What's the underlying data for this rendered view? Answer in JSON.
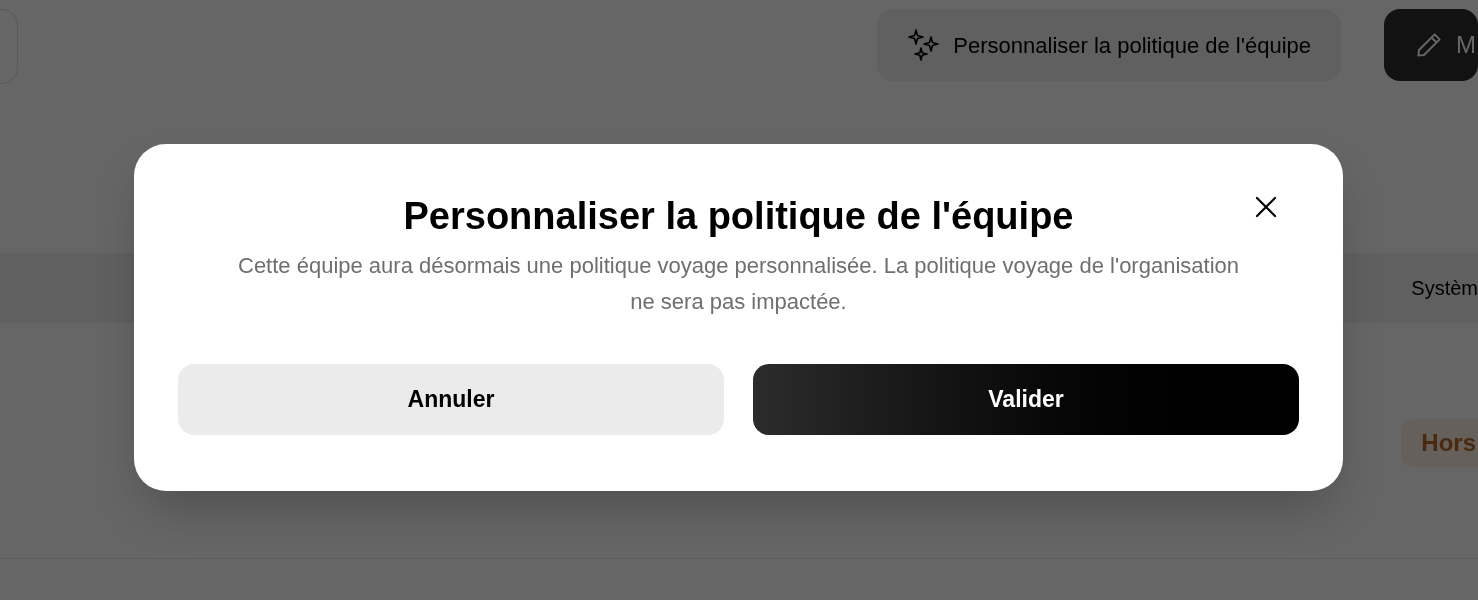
{
  "page": {
    "customize_button": "Personnaliser la politique de l'équipe",
    "edit_button": "M",
    "table_header": "Systèm",
    "badge": "Hors"
  },
  "dialog": {
    "title": "Personnaliser la politique de l'équipe",
    "description": "Cette équipe aura désormais une politique voyage personnalisée. La politique voyage de l'organisation ne sera pas impactée.",
    "buttons": [
      {
        "label": "Annuler",
        "kind": "secondary"
      },
      {
        "label": "Valider",
        "kind": "primary"
      }
    ]
  }
}
